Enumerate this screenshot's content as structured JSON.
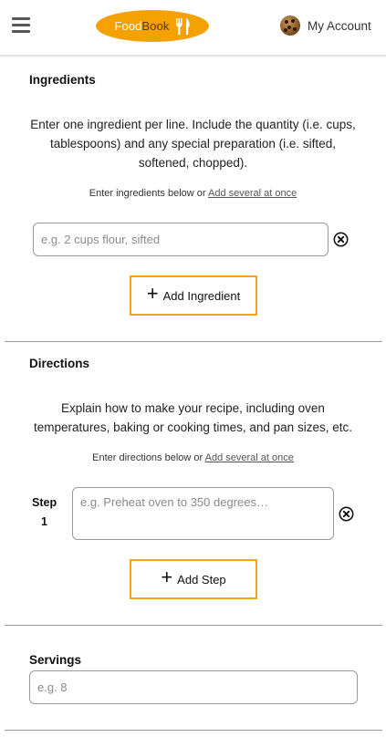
{
  "header": {
    "logo": {
      "part1": "Food",
      "part2": "Book",
      "icon": "fork-knife-icon"
    },
    "menu_icon": "hamburger-menu-icon",
    "account_label": "My Account",
    "avatar_icon": "cookie-avatar-icon"
  },
  "ingredients": {
    "title": "Ingredients",
    "description_lines": [
      "Enter one ingredient per line. Include the quantity (i.e. cups,",
      "tablespoons) and any special preparation (i.e. sifted,",
      "softened, chopped)."
    ],
    "hint_prefix": "Enter ingredients below or",
    "hint_link": "Add several at once",
    "input_placeholder": "e.g. 2 cups flour, sifted",
    "clear_icon": "circle-x-icon",
    "add_button_label": "Add Ingredient"
  },
  "directions": {
    "title": "Directions",
    "description_lines": [
      "Explain how to make your recipe, including oven",
      "temperatures, baking or cooking times, and pan sizes, etc."
    ],
    "hint_prefix": "Enter directions below or",
    "hint_link": "Add several at once",
    "step_word": "Step",
    "step_number": "1",
    "step_placeholder": "e.g. Preheat oven to 350 degrees…",
    "clear_icon": "circle-x-icon",
    "add_button_label": "Add Step"
  },
  "servings": {
    "title": "Servings",
    "input_placeholder": "e.g. 8"
  },
  "colors": {
    "accent": "#f6a102",
    "button_border": "#f4a51c"
  }
}
